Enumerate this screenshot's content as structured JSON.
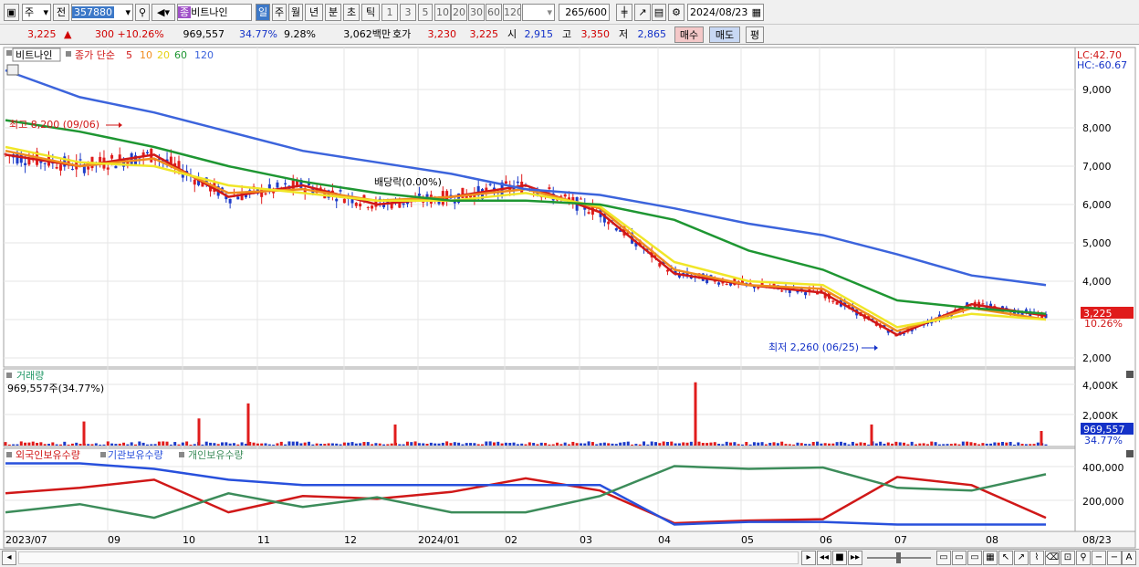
{
  "toolbar": {
    "period_type": "주",
    "prev_label": "전",
    "code": "357880",
    "stock_name": "비트나인",
    "stock_tag": "종",
    "periods": [
      "일",
      "주",
      "월",
      "년",
      "분",
      "초",
      "틱"
    ],
    "active_period": "일",
    "intervals": [
      "1",
      "3",
      "5",
      "10",
      "20",
      "30",
      "60",
      "120"
    ],
    "count": "265",
    "count_total": "/600",
    "date": "2024/08/23"
  },
  "quote": {
    "price": "3,225",
    "change": "300 +10.26%",
    "volume": "969,557",
    "volume_pct": "34.77%",
    "turnover": "9.28%",
    "amount": "3,062백만",
    "hoga_label": "호가",
    "hoga_ask": "3,230",
    "hoga_bid": "3,225",
    "open_label": "시",
    "open": "2,915",
    "high_label": "고",
    "high": "3,350",
    "low_label": "저",
    "low": "2,865",
    "buy_label": "매수",
    "sell_label": "매도",
    "eval_label": "평"
  },
  "price_panel": {
    "stock_label": "비트나인",
    "ma_title": "종가 단순",
    "ma_periods": [
      "5",
      "10",
      "20",
      "60",
      "120"
    ],
    "ma_colors": [
      "#d01818",
      "#f08c1e",
      "#f0e628",
      "#1e9632",
      "#3c64dc"
    ],
    "lc": "LC:42.70",
    "hc": "HC:-60.67",
    "y_ticks": [
      "9,000",
      "8,000",
      "7,000",
      "6,000",
      "5,000",
      "4,000",
      "3,000",
      "2,000"
    ],
    "current_price": "3,225",
    "current_change": "10.26%",
    "high_annotation": "최고 8,200 (09/06)",
    "low_annotation": "최저 2,260 (06/25)",
    "dividend_annotation": "배당락(0.00%)"
  },
  "volume_panel": {
    "title": "거래량",
    "value": "969,557주(34.77%)",
    "y_ticks": [
      "4,000K",
      "2,000K"
    ],
    "current_value": "969,557",
    "current_pct": "34.77%"
  },
  "holding_panel": {
    "series": [
      {
        "name": "외국인보유수량",
        "color": "#d01818"
      },
      {
        "name": "기관보유수량",
        "color": "#2850dc"
      },
      {
        "name": "개인보유수량",
        "color": "#3c8c5a"
      }
    ],
    "y_ticks": [
      "400,000",
      "200,000"
    ]
  },
  "x_axis": [
    "2023/07",
    "09",
    "10",
    "11",
    "12",
    "2024/01",
    "02",
    "03",
    "04",
    "05",
    "06",
    "07",
    "08",
    "08/23"
  ],
  "chart_data": [
    {
      "type": "line",
      "title": "비트나인 종가 단순이동평균 5 10 20 60 120",
      "x": [
        "2023/07",
        "2023/08",
        "2023/09",
        "2023/10",
        "2023/11",
        "2023/12",
        "2024/01",
        "2024/02",
        "2024/03",
        "2024/04",
        "2024/05",
        "2024/06",
        "2024/07",
        "2024/08",
        "2024/08/23"
      ],
      "series": [
        {
          "name": "5",
          "values": [
            7300,
            7000,
            7300,
            6200,
            6500,
            6000,
            6200,
            6500,
            5800,
            4200,
            3900,
            3700,
            2600,
            3400,
            3100
          ]
        },
        {
          "name": "10",
          "values": [
            7400,
            7000,
            7200,
            6300,
            6400,
            6100,
            6200,
            6400,
            5900,
            4300,
            3900,
            3800,
            2700,
            3300,
            3000
          ]
        },
        {
          "name": "20",
          "values": [
            7500,
            7100,
            7000,
            6500,
            6300,
            6100,
            6100,
            6300,
            5950,
            4500,
            4000,
            3900,
            2800,
            3150,
            3000
          ]
        },
        {
          "name": "60",
          "values": [
            8200,
            7900,
            7500,
            7000,
            6600,
            6300,
            6100,
            6100,
            6000,
            5600,
            4800,
            4300,
            3500,
            3300,
            3150
          ]
        },
        {
          "name": "120",
          "values": [
            9500,
            8800,
            8400,
            7900,
            7400,
            7100,
            6800,
            6400,
            6250,
            5900,
            5500,
            5200,
            4700,
            4150,
            3900
          ]
        }
      ],
      "ylim": [
        2000,
        9000
      ],
      "annotations": [
        "최고 8,200 (09/06)",
        "최저 2,260 (06/25)",
        "배당락(0.00%)"
      ]
    },
    {
      "type": "bar",
      "title": "거래량",
      "notable_values": [
        {
          "x": "2023/08",
          "value": 1600000
        },
        {
          "x": "2023/10",
          "value": 1800000
        },
        {
          "x": "2023/11",
          "value": 2800000
        },
        {
          "x": "2024/01",
          "value": 1400000
        },
        {
          "x": "2024/04",
          "value": 4200000
        },
        {
          "x": "2024/06",
          "value": 1400000
        },
        {
          "x": "2024/08/23",
          "value": 969557
        }
      ],
      "ylim": [
        0,
        4500000
      ]
    },
    {
      "type": "line",
      "title": "보유수량",
      "x": [
        "2023/07",
        "2023/08",
        "2023/09",
        "2023/10",
        "2023/11",
        "2023/12",
        "2024/01",
        "2024/02",
        "2024/03",
        "2024/04",
        "2024/05",
        "2024/06",
        "2024/07",
        "2024/08",
        "2024/08/23"
      ],
      "series": [
        {
          "name": "외국인보유수량",
          "values": [
            260000,
            300000,
            360000,
            120000,
            240000,
            220000,
            270000,
            370000,
            280000,
            40000,
            60000,
            70000,
            380000,
            320000,
            80000
          ]
        },
        {
          "name": "기관보유수량",
          "values": [
            480000,
            480000,
            440000,
            360000,
            320000,
            320000,
            320000,
            320000,
            320000,
            30000,
            50000,
            50000,
            30000,
            30000,
            30000
          ]
        },
        {
          "name": "개인보유수량",
          "values": [
            120000,
            180000,
            80000,
            260000,
            160000,
            230000,
            120000,
            120000,
            240000,
            460000,
            440000,
            450000,
            300000,
            280000,
            400000
          ]
        }
      ],
      "ylim": [
        0,
        500000
      ]
    }
  ]
}
